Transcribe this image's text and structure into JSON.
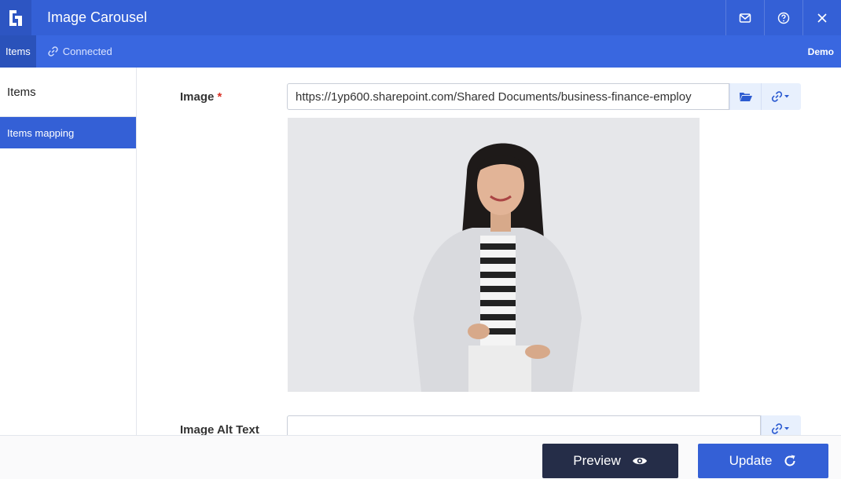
{
  "app": {
    "title": "Image Carousel",
    "accent": "#3460d6"
  },
  "titlebar": {
    "icons": [
      "app-logo-icon",
      "mail-icon",
      "help-icon",
      "close-icon"
    ]
  },
  "navbar": {
    "tab_label": "Items",
    "status_label": "Connected",
    "environment_label": "Demo"
  },
  "sidebar": {
    "heading": "Items",
    "items": [
      {
        "label": "Items mapping",
        "active": true
      }
    ]
  },
  "form": {
    "image": {
      "label": "Image",
      "required_marker": "*",
      "value": "https://1yp600.sharepoint.com/Shared Documents/business-finance-employ",
      "browse_icon": "folder-open-icon",
      "link_icon": "link-dropdown-icon"
    },
    "alt_text": {
      "label": "Image Alt Text",
      "value": "",
      "link_icon": "link-dropdown-icon"
    }
  },
  "footer": {
    "preview_label": "Preview",
    "preview_icon": "eye-icon",
    "update_label": "Update",
    "update_icon": "refresh-icon"
  }
}
